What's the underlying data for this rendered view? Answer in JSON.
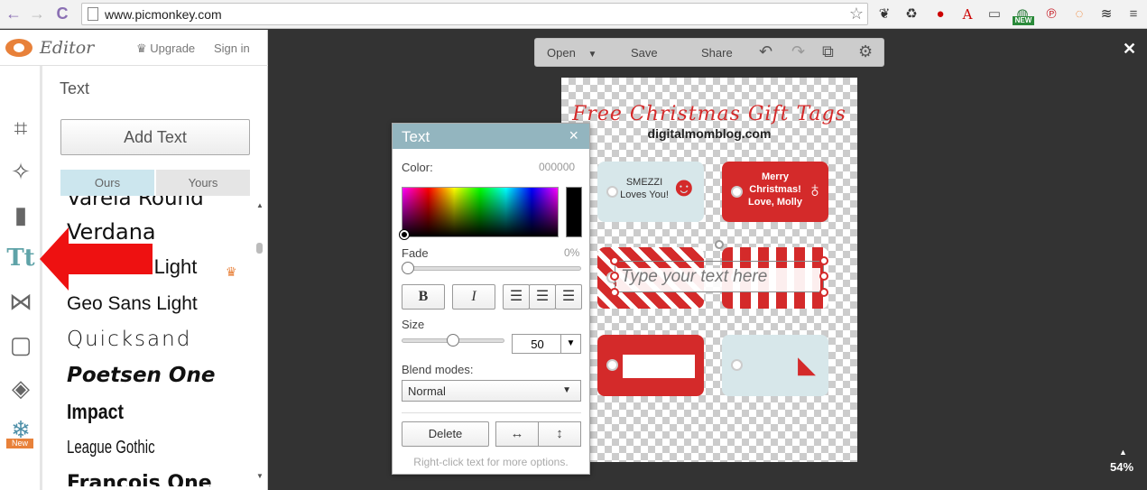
{
  "browser": {
    "url": "www.picmonkey.com",
    "nav": {
      "back": "←",
      "forward": "→",
      "reload": "C"
    },
    "ext_new_badge": "NEW"
  },
  "header": {
    "app_name": "Editor",
    "upgrade_label": "Upgrade",
    "signin_label": "Sign in"
  },
  "tools": {
    "new_badge": "New",
    "text_tool_label": "Tt"
  },
  "panel": {
    "title": "Text",
    "add_text_label": "Add Text",
    "tabs": {
      "ours": "Ours",
      "yours": "Yours"
    },
    "fonts": [
      "Varela Round",
      "Verdana",
      "Helvetica Light",
      "Geo Sans Light",
      "Quicksand",
      "Poetsen One",
      "Impact",
      "League Gothic",
      "Francois One"
    ]
  },
  "toolbar": {
    "open_label": "Open",
    "save_label": "Save",
    "share_label": "Share"
  },
  "canvas": {
    "zoom": "54%",
    "title": "Free Christmas Gift Tags",
    "subtitle": "digitalmomblog.com",
    "tag1_text": "SMEZZI\nLoves You!",
    "tag2_text": "Merry\nChristmas!\nLove, Molly",
    "placeholder_text": "Type your text here"
  },
  "dialog": {
    "title": "Text",
    "color_label": "Color:",
    "color_hex": "000000",
    "fade_label": "Fade",
    "fade_value": "0%",
    "fade_fraction": 0,
    "bold_label": "B",
    "italic_label": "I",
    "size_label": "Size",
    "size_value": "50",
    "size_fraction": 0.5,
    "blend_label": "Blend modes:",
    "blend_value": "Normal",
    "delete_label": "Delete",
    "hint": "Right-click text for more options."
  },
  "colors": {
    "accent": "#93b5bf",
    "brand_orange": "#e8813a",
    "tag_red": "#d42a2a",
    "tag_light": "#d7e7ea",
    "arrow_red": "#ee1111"
  }
}
